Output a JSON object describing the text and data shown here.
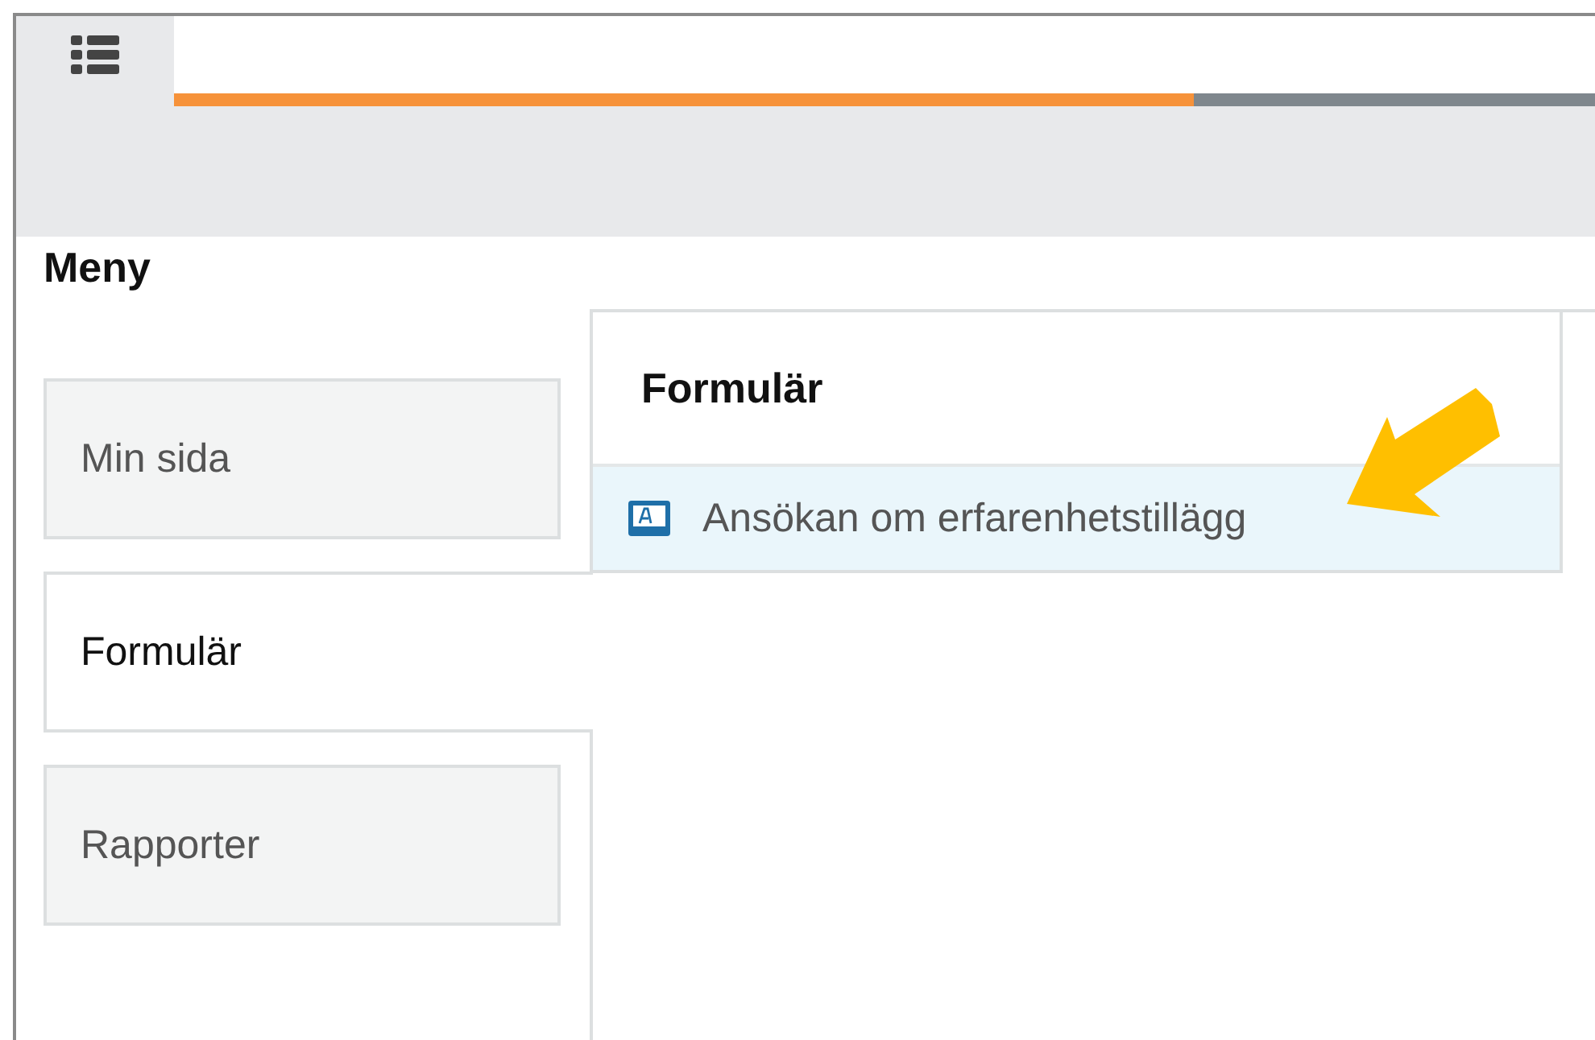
{
  "header": {
    "progress": {
      "level": 0.718
    }
  },
  "menu": {
    "title": "Meny",
    "tabs": [
      {
        "label": "Min sida",
        "selected": false
      },
      {
        "label": "Formulär",
        "selected": true
      },
      {
        "label": "Rapporter",
        "selected": false
      }
    ]
  },
  "panel": {
    "title": "Formulär",
    "items": [
      {
        "label": "Ansökan om erfarenhetstillägg",
        "highlighted": true
      }
    ]
  },
  "annotation": {
    "kind": "arrow"
  }
}
